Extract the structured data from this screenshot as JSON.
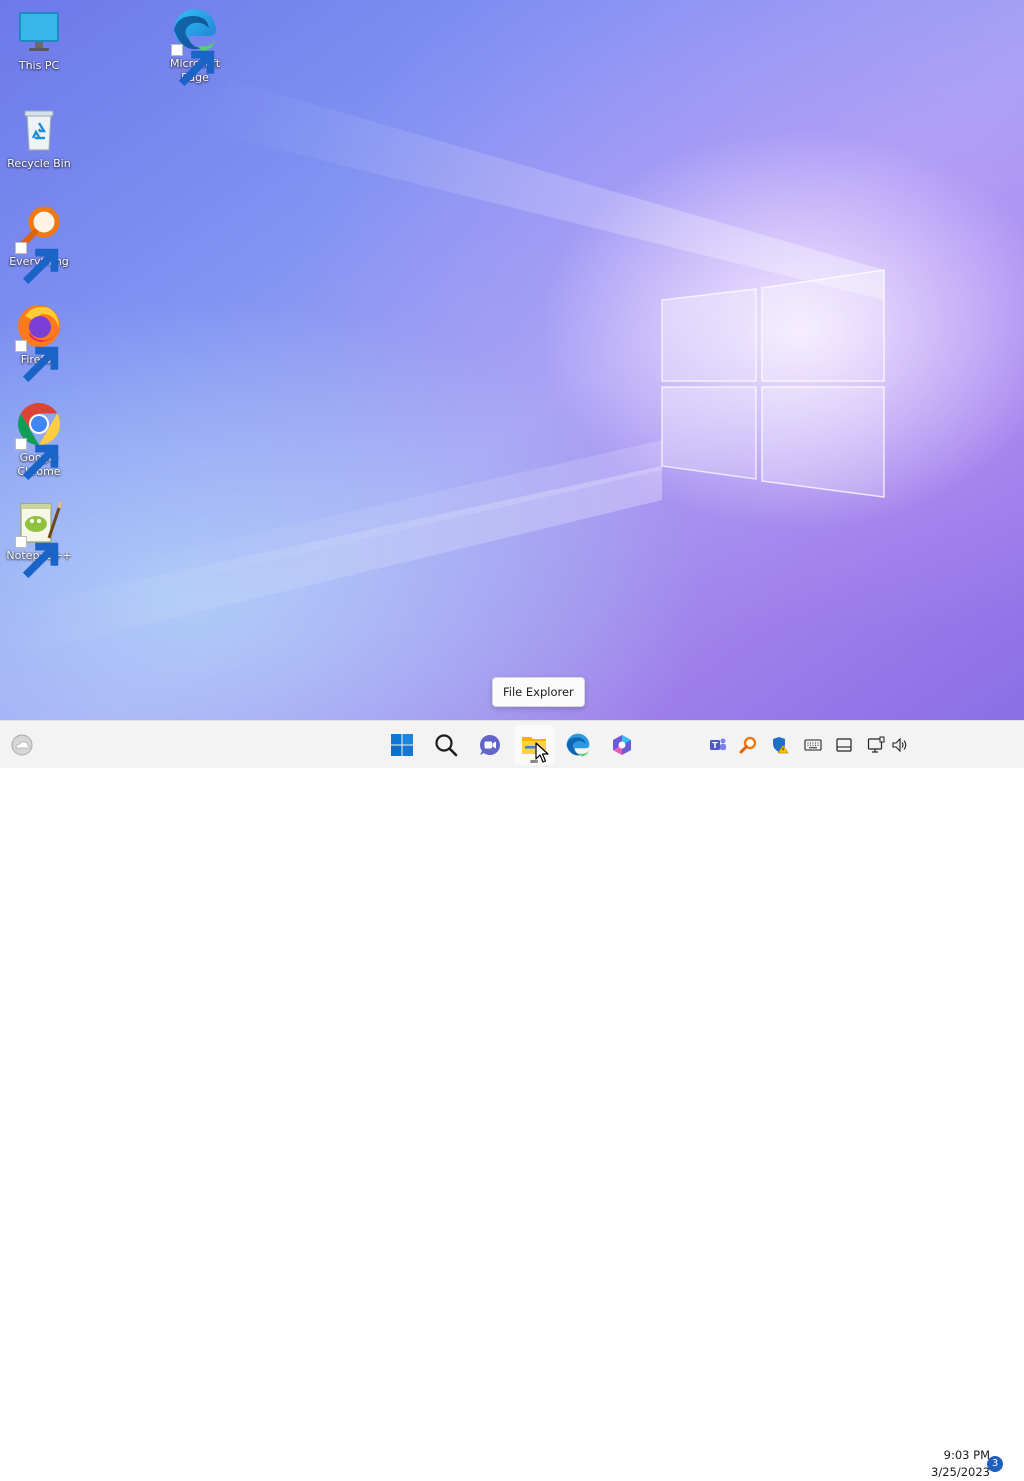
{
  "desktop": {
    "icons": [
      {
        "label": "This PC",
        "icon": "monitor-icon"
      },
      {
        "label": "Recycle Bin",
        "icon": "recycle-bin-icon"
      },
      {
        "label": "Everything",
        "icon": "magnifier-icon"
      },
      {
        "label": "Firefox",
        "icon": "firefox-icon"
      },
      {
        "label": "Google Chrome",
        "icon": "chrome-icon"
      },
      {
        "label": "Notepad++",
        "icon": "notepadpp-icon"
      },
      {
        "label": "Microsoft Edge",
        "icon": "edge-icon"
      }
    ]
  },
  "tooltip": {
    "text": "File Explorer"
  },
  "taskbar": {
    "widgets_icon": "weather-icon",
    "pinned": [
      {
        "name": "Start",
        "icon": "windows-logo-icon"
      },
      {
        "name": "Search",
        "icon": "search-icon"
      },
      {
        "name": "Chat",
        "icon": "chat-camera-icon"
      },
      {
        "name": "File Explorer",
        "icon": "folder-icon",
        "active": true
      },
      {
        "name": "Microsoft Edge",
        "icon": "edge-icon"
      },
      {
        "name": "Copilot",
        "icon": "copilot-icon"
      }
    ],
    "tray": [
      "teams-icon",
      "everything-icon",
      "security-warning-icon",
      "keyboard-icon",
      "display-icon",
      "network-icon",
      "volume-icon"
    ],
    "clock": {
      "time": "9:03 PM",
      "date": "3/25/2023"
    },
    "notifications": "3"
  },
  "colors": {
    "taskbar_bg": "#f3f3f3",
    "accent": "#0067c0",
    "badge": "#1f5fbf"
  }
}
